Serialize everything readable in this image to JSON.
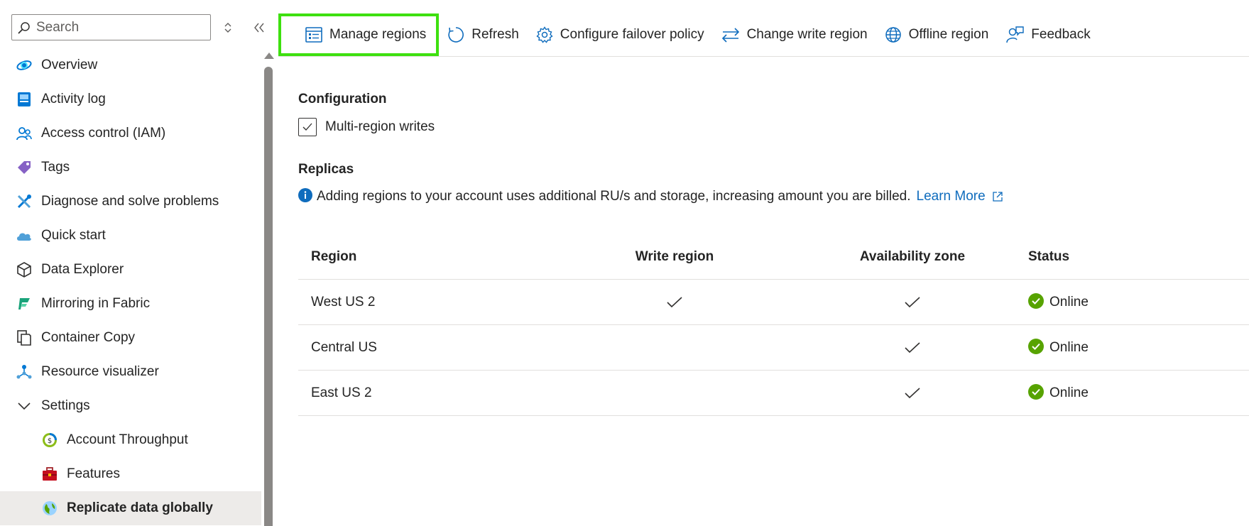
{
  "sidebar": {
    "search_placeholder": "Search",
    "items": [
      {
        "label": "Overview",
        "icon": "overview-icon"
      },
      {
        "label": "Activity log",
        "icon": "activity-log-icon"
      },
      {
        "label": "Access control (IAM)",
        "icon": "access-control-icon"
      },
      {
        "label": "Tags",
        "icon": "tag-icon"
      },
      {
        "label": "Diagnose and solve problems",
        "icon": "wrench-icon"
      },
      {
        "label": "Quick start",
        "icon": "cloud-icon"
      },
      {
        "label": "Data Explorer",
        "icon": "cube-icon"
      },
      {
        "label": "Mirroring in Fabric",
        "icon": "fabric-icon"
      },
      {
        "label": "Container Copy",
        "icon": "copy-icon"
      },
      {
        "label": "Resource visualizer",
        "icon": "hierarchy-icon"
      }
    ],
    "settings_group": "Settings",
    "sub_items": [
      {
        "label": "Account Throughput",
        "icon": "throughput-icon"
      },
      {
        "label": "Features",
        "icon": "toolbox-icon"
      },
      {
        "label": "Replicate data globally",
        "icon": "globe-icon"
      }
    ]
  },
  "toolbar": {
    "manage_regions": "Manage regions",
    "refresh": "Refresh",
    "configure_failover": "Configure failover policy",
    "change_write_region": "Change write region",
    "offline_region": "Offline region",
    "feedback": "Feedback"
  },
  "content": {
    "configuration_title": "Configuration",
    "multi_region_label": "Multi-region writes",
    "multi_region_checked": true,
    "replicas_title": "Replicas",
    "info_text": "Adding regions to your account uses additional RU/s and storage, increasing amount you are billed.",
    "learn_more": "Learn More"
  },
  "table": {
    "headers": {
      "region": "Region",
      "write_region": "Write region",
      "availability_zone": "Availability zone",
      "status": "Status"
    },
    "rows": [
      {
        "region": "West US 2",
        "write_region": true,
        "availability_zone": true,
        "status": "Online"
      },
      {
        "region": "Central US",
        "write_region": false,
        "availability_zone": true,
        "status": "Online"
      },
      {
        "region": "East US 2",
        "write_region": false,
        "availability_zone": true,
        "status": "Online"
      }
    ]
  },
  "colors": {
    "accent": "#0f6cbd",
    "highlight": "#3ee00f",
    "online": "#57a300"
  }
}
